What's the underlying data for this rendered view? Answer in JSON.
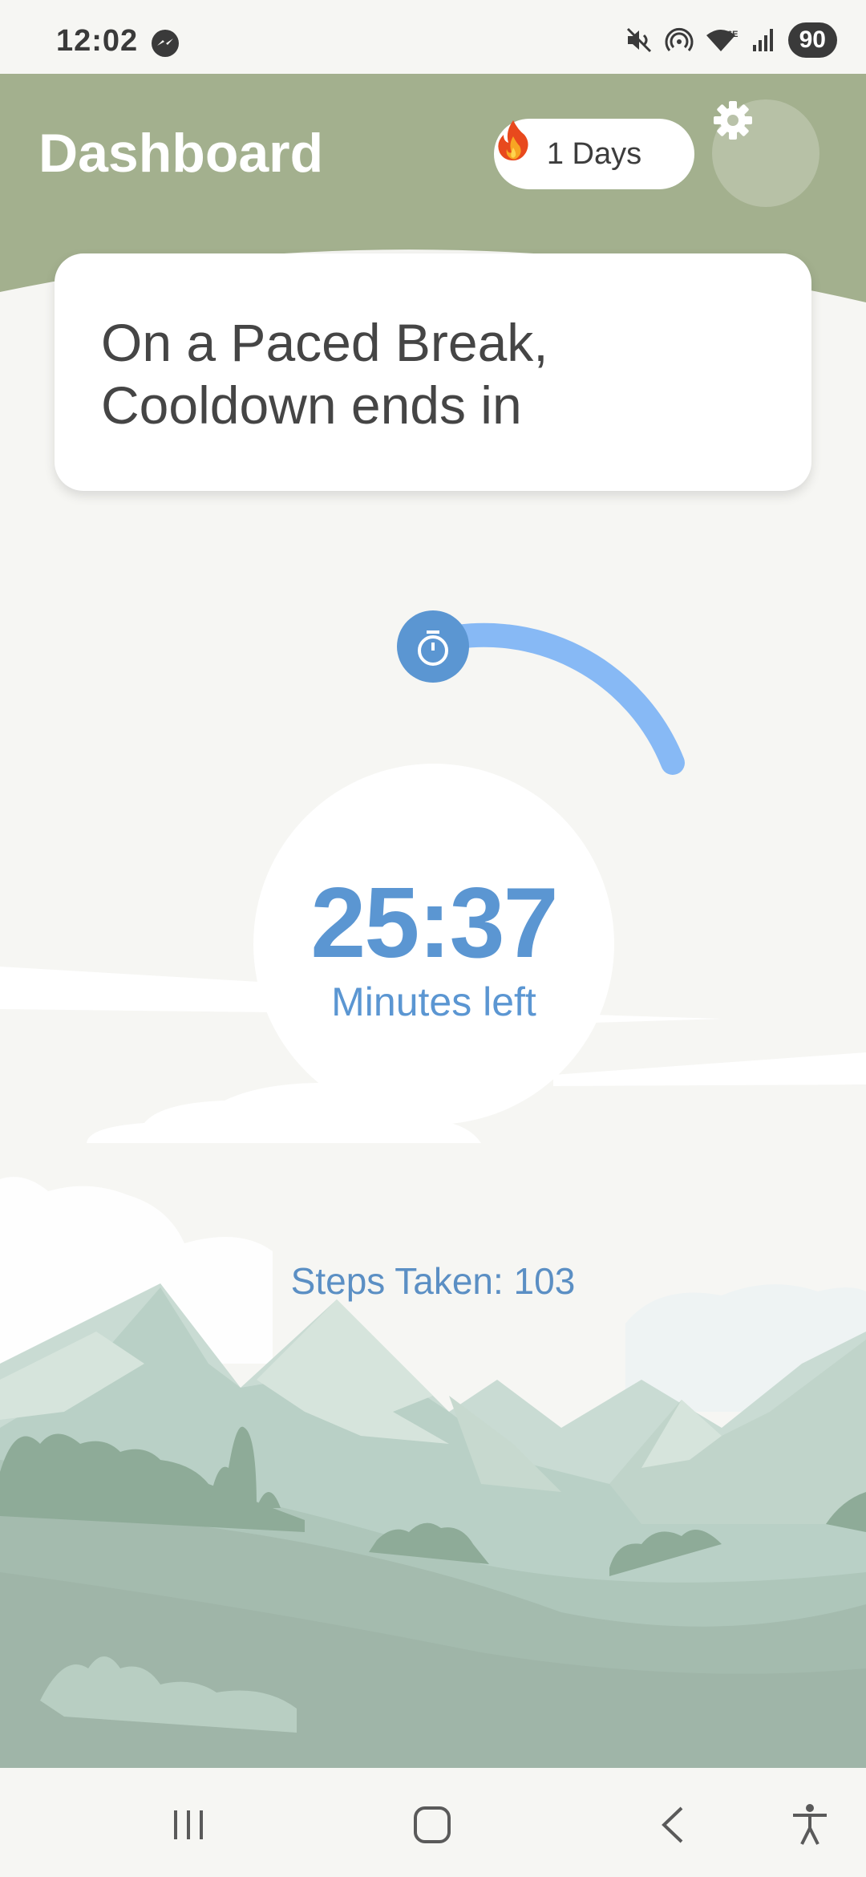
{
  "status_bar": {
    "time": "12:02",
    "battery": "90",
    "icons": [
      "messenger-icon",
      "mute-icon",
      "hotspot-icon",
      "wifi-icon",
      "signal-icon"
    ]
  },
  "header": {
    "title": "Dashboard",
    "streak_label": "1 Days",
    "streak_icon": "fire-icon",
    "settings_icon": "gear-icon",
    "background_color": "#a3b08e"
  },
  "status_card": {
    "line1": "On a Paced Break,",
    "line2": "Cooldown ends in"
  },
  "timer": {
    "value": "25:37",
    "label": "Minutes left",
    "icon": "stopwatch-icon",
    "accent_color": "#5b96d2",
    "arc_color": "#87b9f5"
  },
  "steps": {
    "text": "Steps Taken: 103"
  },
  "nav_bar": {
    "icons": [
      "recent-apps-icon",
      "home-icon",
      "back-icon",
      "accessibility-icon"
    ]
  }
}
